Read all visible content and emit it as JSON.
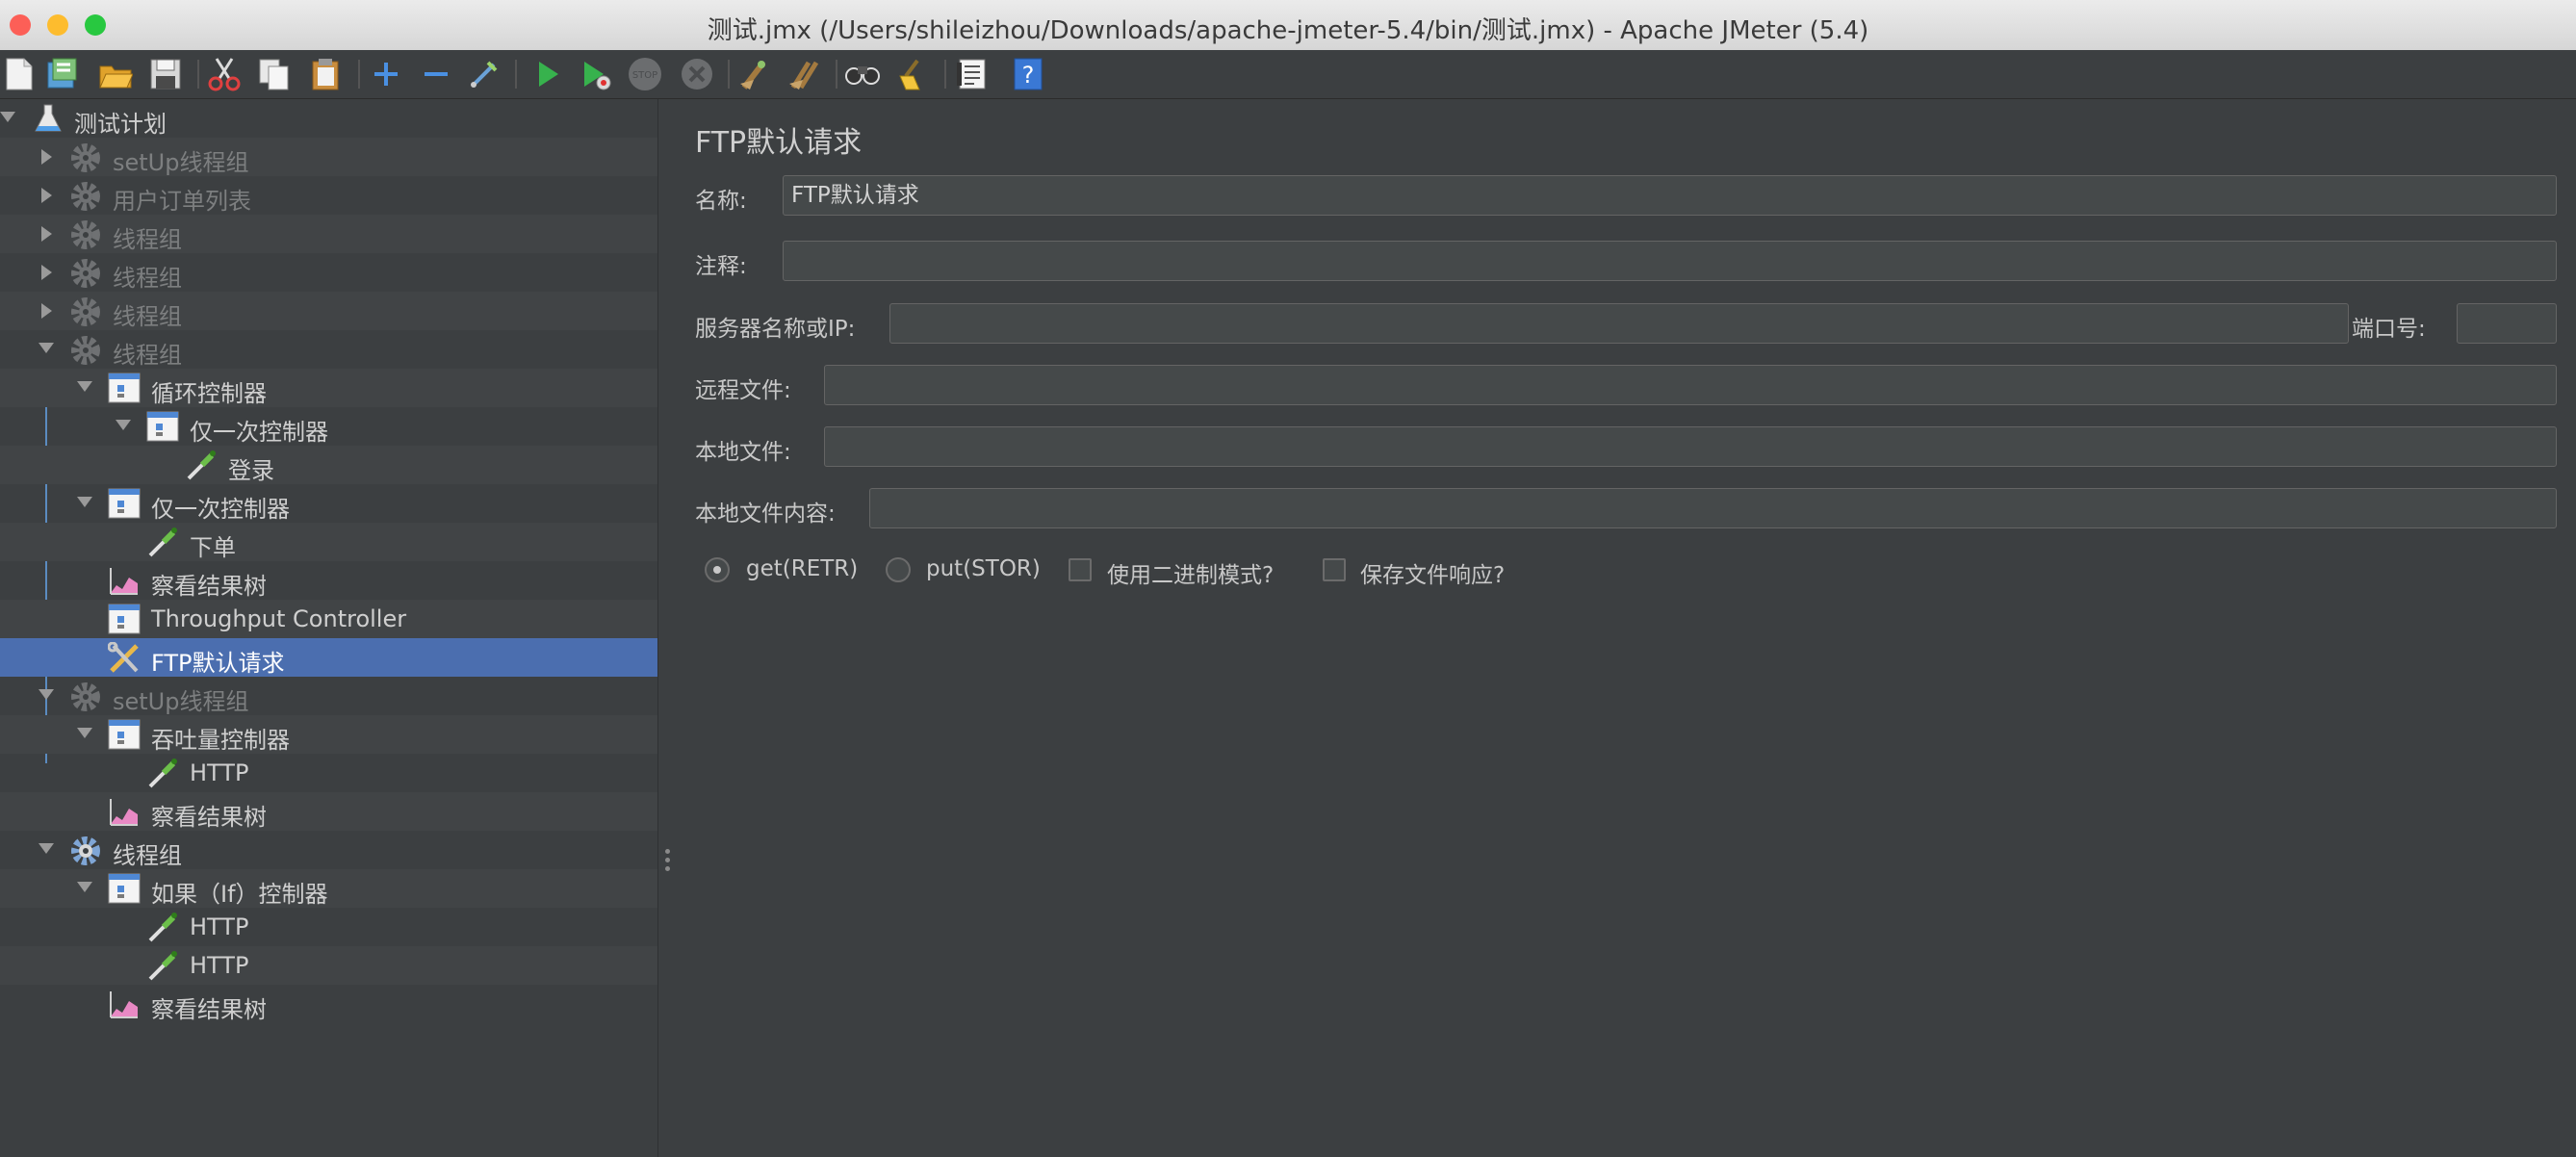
{
  "window": {
    "title": "测试.jmx (/Users/shileizhou/Downloads/apache-jmeter-5.4/bin/测试.jmx) - Apache JMeter (5.4)",
    "traffic_lights": {
      "close": "#fc5f57",
      "minimize": "#fdbc2e",
      "maximize": "#28c840"
    }
  },
  "toolbar": {
    "buttons": [
      "new-icon",
      "templates-icon",
      "open-icon",
      "save-icon",
      "cut-icon",
      "copy-icon",
      "paste-icon",
      "expand-icon",
      "collapse-icon",
      "toggle-icon",
      "start-icon",
      "start-no-pause-icon",
      "stop-icon",
      "shutdown-icon",
      "clear-icon",
      "clear-all-icon",
      "search-icon",
      "reset-search-icon",
      "function-helper-icon",
      "help-icon"
    ]
  },
  "tree": {
    "items": [
      {
        "label": "测试计划",
        "icon": "test-plan-icon",
        "expanded": true,
        "disabled": false
      },
      {
        "label": "setUp线程组",
        "icon": "gear-icon",
        "expanded": false,
        "disabled": true
      },
      {
        "label": "用户订单列表",
        "icon": "gear-icon",
        "expanded": false,
        "disabled": true
      },
      {
        "label": "线程组",
        "icon": "gear-icon",
        "expanded": false,
        "disabled": true
      },
      {
        "label": "线程组",
        "icon": "gear-icon",
        "expanded": false,
        "disabled": true
      },
      {
        "label": "线程组",
        "icon": "gear-icon",
        "expanded": false,
        "disabled": true
      },
      {
        "label": "线程组",
        "icon": "gear-icon",
        "expanded": true,
        "disabled": true
      },
      {
        "label": "循环控制器",
        "icon": "controller-icon",
        "expanded": true,
        "disabled": false
      },
      {
        "label": "仅一次控制器",
        "icon": "controller-icon",
        "expanded": true,
        "disabled": false
      },
      {
        "label": "登录",
        "icon": "sampler-pipette-icon",
        "disabled": false
      },
      {
        "label": "仅一次控制器",
        "icon": "controller-icon",
        "expanded": true,
        "disabled": false
      },
      {
        "label": "下单",
        "icon": "sampler-pipette-icon",
        "disabled": false
      },
      {
        "label": "察看结果树",
        "icon": "listener-graph-icon",
        "disabled": false
      },
      {
        "label": "Throughput Controller",
        "icon": "controller-icon",
        "disabled": false
      },
      {
        "label": "FTP默认请求",
        "icon": "config-tools-icon",
        "disabled": false,
        "selected": true
      },
      {
        "label": "setUp线程组",
        "icon": "gear-icon",
        "expanded": true,
        "disabled": true
      },
      {
        "label": "吞吐量控制器",
        "icon": "controller-icon",
        "expanded": true,
        "disabled": false
      },
      {
        "label": "HTTP",
        "icon": "sampler-pipette-icon",
        "disabled": false
      },
      {
        "label": "察看结果树",
        "icon": "listener-graph-icon",
        "disabled": false
      },
      {
        "label": "线程组",
        "icon": "gear-icon",
        "expanded": true,
        "disabled": false
      },
      {
        "label": "如果（If）控制器",
        "icon": "controller-icon",
        "expanded": true,
        "disabled": false
      },
      {
        "label": "HTTP",
        "icon": "sampler-pipette-icon",
        "disabled": false
      },
      {
        "label": "HTTP",
        "icon": "sampler-pipette-icon",
        "disabled": false
      },
      {
        "label": "察看结果树",
        "icon": "listener-graph-icon",
        "disabled": false
      }
    ]
  },
  "panel": {
    "title": "FTP默认请求",
    "name_label": "名称:",
    "name_value": "FTP默认请求",
    "comment_label": "注释:",
    "comment_value": "",
    "server_label": "服务器名称或IP:",
    "server_value": "",
    "port_label": "端口号:",
    "port_value": "",
    "remote_label": "远程文件:",
    "remote_value": "",
    "local_label": "本地文件:",
    "local_value": "",
    "content_label": "本地文件内容:",
    "content_value": "",
    "get_label": "get(RETR)",
    "put_label": "put(STOR)",
    "binary_label": "使用二进制模式?",
    "save_label": "保存文件响应?",
    "get_selected": true,
    "put_selected": false,
    "binary_checked": false,
    "save_checked": false
  },
  "colors": {
    "selection": "#4b6eaf",
    "background": "#3c3f41",
    "field": "#45494a"
  }
}
